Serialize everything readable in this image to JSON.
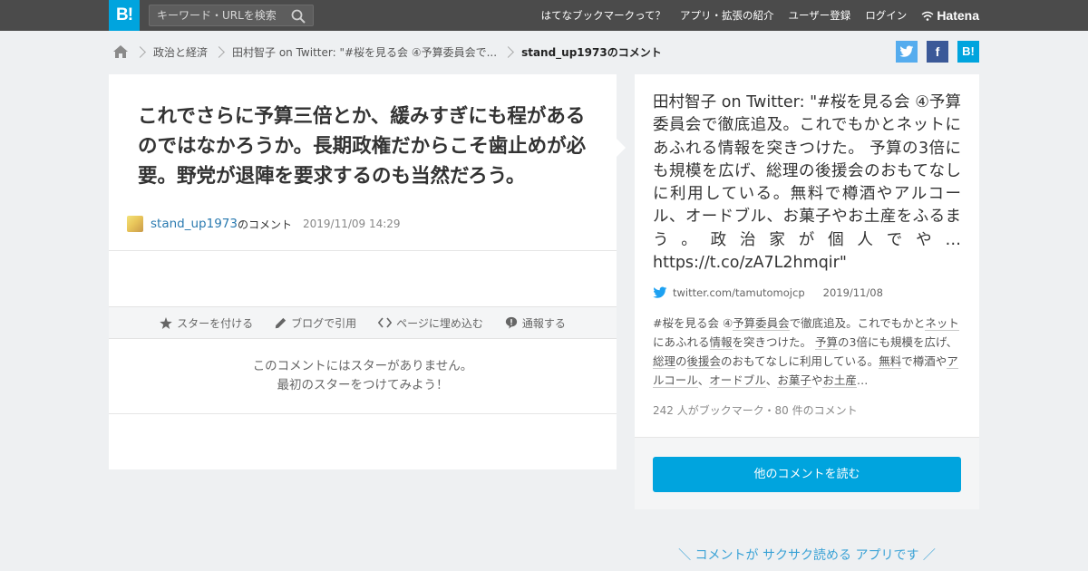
{
  "topbar": {
    "logo": "B!",
    "search_placeholder": "キーワード・URLを検索",
    "nav": [
      "はてなブックマークって？",
      "アプリ・拡張の紹介",
      "ユーザー登録",
      "ログイン"
    ],
    "brand": "Hatena"
  },
  "breadcrumb": {
    "items": [
      "政治と経済",
      "田村智子 on Twitter: \"#桜を見る会 ④予算委員会で...",
      "stand_up1973のコメント"
    ]
  },
  "share": {
    "facebook": "f",
    "hatena": "B!"
  },
  "comment": {
    "text": "これでさらに予算三倍とか、緩みすぎにも程があるのではなかろうか。長期政権だからこそ歯止めが必要。野党が退陣を要求するのも当然だろう。",
    "username": "stand_up1973",
    "suffix": "のコメント",
    "date": "2019/11/09 14:29"
  },
  "actions": {
    "star": "スターを付ける",
    "blog": "ブログで引用",
    "embed": "ページに埋め込む",
    "report": "通報する"
  },
  "no_star": {
    "line1": "このコメントにはスターがありません。",
    "line2": "最初のスターをつけてみよう！"
  },
  "entry": {
    "title": "田村智子 on Twitter: \"#桜を見る会 ④予算委員会で徹底追及。これでもかとネットにあふれる情報を突きつけた。 予算の3倍にも規模を広げ、総理の後援会のおもてなしに利用している。無料で樽酒やアルコール、オードブル、お菓子やお土産をふるまう。政治家が個人でや… https://t.co/zA7L2hmqir\"",
    "domain": "twitter.com/tamutomojcp",
    "date": "2019/11/08",
    "summary_parts": [
      {
        "t": "#桜を見る会 ④",
        "k": false
      },
      {
        "t": "予算委員会",
        "k": true
      },
      {
        "t": "で徹底追及。これでもかと",
        "k": false
      },
      {
        "t": "ネット",
        "k": true
      },
      {
        "t": "にあふれる",
        "k": false
      },
      {
        "t": "情報",
        "k": true
      },
      {
        "t": "を突きつけた。 ",
        "k": false
      },
      {
        "t": "予算",
        "k": true
      },
      {
        "t": "の3倍にも規模を広げ、",
        "k": false
      },
      {
        "t": "総理",
        "k": true
      },
      {
        "t": "の",
        "k": false
      },
      {
        "t": "後援会",
        "k": true
      },
      {
        "t": "のおもてなしに利用している。",
        "k": false
      },
      {
        "t": "無料",
        "k": true
      },
      {
        "t": "で樽酒や",
        "k": false
      },
      {
        "t": "アルコール",
        "k": true
      },
      {
        "t": "、",
        "k": false
      },
      {
        "t": "オードブル",
        "k": true
      },
      {
        "t": "、",
        "k": false
      },
      {
        "t": "お菓子",
        "k": true
      },
      {
        "t": "や",
        "k": false
      },
      {
        "t": "お土産",
        "k": true
      },
      {
        "t": "…",
        "k": false
      }
    ],
    "counts": "242 人がブックマーク・80 件のコメント",
    "read_button": "他のコメントを読む"
  },
  "app_promo": "＼ コメントが サクサク読める アプリです ／",
  "colors": {
    "topbar": "#4b4b4b",
    "accent": "#00a4de",
    "twitter": "#55acee",
    "facebook": "#3b5998"
  }
}
